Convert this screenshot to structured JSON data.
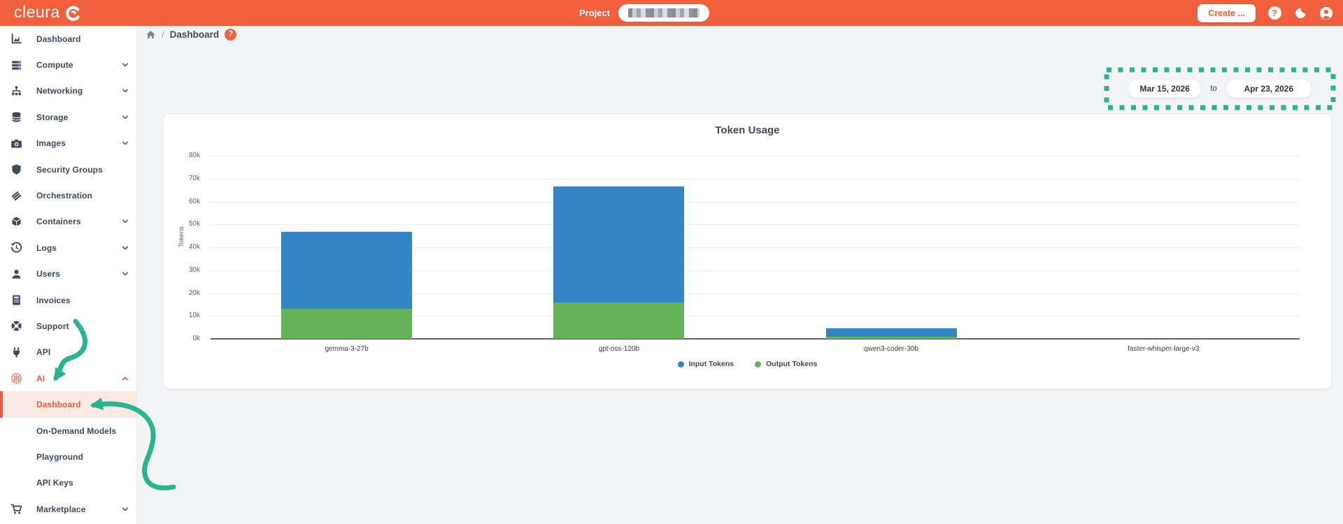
{
  "topbar": {
    "logo_text": "cleura",
    "logo_mark_icon": "cleura-c-icon",
    "project_label": "Project",
    "project_value_masked": true,
    "create_button_label": "Create ...",
    "right_icons": [
      "help-icon",
      "dark-mode-icon",
      "account-icon"
    ]
  },
  "breadcrumb": {
    "home_icon": "home-icon",
    "separator": "/",
    "page": "Dashboard",
    "help_icon": "help-icon"
  },
  "date_range": {
    "start": "Mar 15, 2026",
    "separator": "to",
    "end": "Apr 23, 2026"
  },
  "sidebar": {
    "items": [
      {
        "label": "Dashboard",
        "icon": "dashboard-icon",
        "chevron": null,
        "type": "item"
      },
      {
        "label": "Compute",
        "icon": "compute-icon",
        "chevron": "down",
        "type": "item"
      },
      {
        "label": "Networking",
        "icon": "networking-icon",
        "chevron": "down",
        "type": "item"
      },
      {
        "label": "Storage",
        "icon": "storage-icon",
        "chevron": "down",
        "type": "item"
      },
      {
        "label": "Images",
        "icon": "images-icon",
        "chevron": "down",
        "type": "item"
      },
      {
        "label": "Security Groups",
        "icon": "security-groups-icon",
        "chevron": null,
        "type": "item"
      },
      {
        "label": "Orchestration",
        "icon": "orchestration-icon",
        "chevron": null,
        "type": "item"
      },
      {
        "label": "Containers",
        "icon": "containers-icon",
        "chevron": "down",
        "type": "item"
      },
      {
        "label": "Logs",
        "icon": "logs-icon",
        "chevron": "down",
        "type": "item"
      },
      {
        "label": "Users",
        "icon": "users-icon",
        "chevron": "down",
        "type": "item"
      },
      {
        "label": "Invoices",
        "icon": "invoices-icon",
        "chevron": null,
        "type": "item"
      },
      {
        "label": "Support",
        "icon": "support-icon",
        "chevron": null,
        "type": "item"
      },
      {
        "label": "API",
        "icon": "api-icon",
        "chevron": null,
        "type": "item"
      },
      {
        "label": "AI",
        "icon": "ai-icon",
        "chevron": "up",
        "type": "item",
        "accent": true
      },
      {
        "label": "Dashboard",
        "icon": null,
        "chevron": null,
        "type": "subitem",
        "active": true
      },
      {
        "label": "On-Demand Models",
        "icon": null,
        "chevron": null,
        "type": "subitem"
      },
      {
        "label": "Playground",
        "icon": null,
        "chevron": null,
        "type": "subitem"
      },
      {
        "label": "API Keys",
        "icon": null,
        "chevron": null,
        "type": "subitem"
      },
      {
        "label": "Marketplace",
        "icon": "marketplace-icon",
        "chevron": "down",
        "type": "item"
      }
    ]
  },
  "chart_data": {
    "type": "bar",
    "stacked": true,
    "title": "Token Usage",
    "xlabel": "",
    "ylabel": "Tokens",
    "categories": [
      "gemma-3-27b",
      "gpt-oss-120b",
      "qwen3-coder-30b",
      "faster-whisper-large-v3"
    ],
    "series": [
      {
        "name": "Input Tokens",
        "color": "#3385c6",
        "values": [
          34000,
          51000,
          4000,
          0
        ]
      },
      {
        "name": "Output Tokens",
        "color": "#66b259",
        "values": [
          13000,
          16000,
          1000,
          0
        ]
      }
    ],
    "stack_order_bottom_to_top": [
      "Output Tokens",
      "Input Tokens"
    ],
    "totals": [
      47000,
      67000,
      5000,
      0
    ],
    "ylim": [
      0,
      80000
    ],
    "ytick_step": 10000,
    "ytick_labels": [
      "0k",
      "10k",
      "20k",
      "30k",
      "40k",
      "50k",
      "60k",
      "70k",
      "80k"
    ],
    "grid": true,
    "legend_position": "bottom"
  },
  "annotations": {
    "color": "#2ab390",
    "items": [
      "dashed-box-around-date-range",
      "arrow-to-ai-menu-item",
      "arrow-to-dashboard-subitem"
    ]
  },
  "colors": {
    "topbar_bg": "#f25f3d",
    "accent": "#f35b3f",
    "page_bg": "#f3f4f6",
    "sidebar_text": "#3e4b5f",
    "bar_blue": "#3385c6",
    "bar_green": "#66b259"
  }
}
